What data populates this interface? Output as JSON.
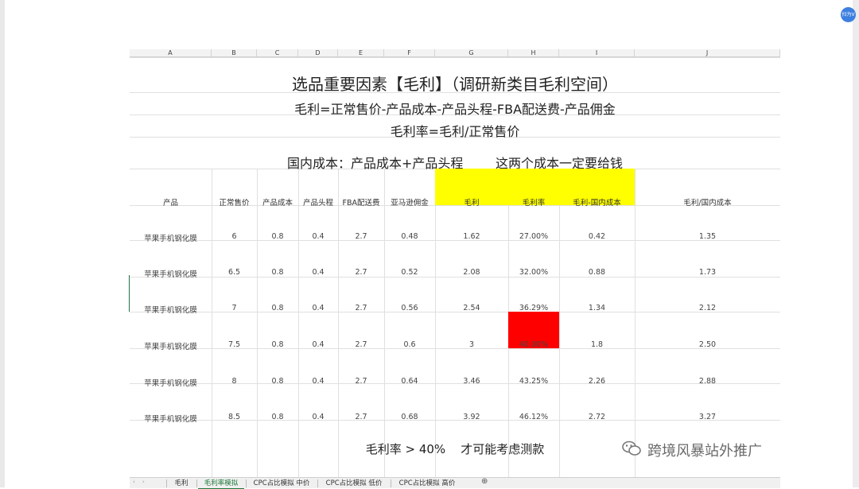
{
  "avatar_text": "扫为V",
  "columns": [
    "A",
    "B",
    "C",
    "D",
    "E",
    "F",
    "G",
    "H",
    "I",
    "J"
  ],
  "title": "选品重要因素【毛利】（调研新类目毛利空间）",
  "formula1": "毛利=正常售价-产品成本-产品头程-FBA配送费-产品佣金",
  "formula2": "毛利率=毛利/正常售价",
  "domestic": "国内成本：产品成本+产品头程        这两个成本一定要给钱",
  "headers": [
    "产品",
    "正常售价",
    "产品成本",
    "产品头程",
    "FBA配送费",
    "亚马逊佣金",
    "毛利",
    "毛利率",
    "毛利-国内成本",
    "毛利/国内成本"
  ],
  "rows": [
    [
      "苹果手机钢化膜",
      "6",
      "0.8",
      "0.4",
      "2.7",
      "0.48",
      "1.62",
      "27.00%",
      "0.42",
      "1.35"
    ],
    [
      "苹果手机钢化膜",
      "6.5",
      "0.8",
      "0.4",
      "2.7",
      "0.52",
      "2.08",
      "32.00%",
      "0.88",
      "1.73"
    ],
    [
      "苹果手机钢化膜",
      "7",
      "0.8",
      "0.4",
      "2.7",
      "0.56",
      "2.54",
      "36.29%",
      "1.34",
      "2.12"
    ],
    [
      "苹果手机钢化膜",
      "7.5",
      "0.8",
      "0.4",
      "2.7",
      "0.6",
      "3",
      "40.00%",
      "1.8",
      "2.50"
    ],
    [
      "苹果手机钢化膜",
      "8",
      "0.8",
      "0.4",
      "2.7",
      "0.64",
      "3.46",
      "43.25%",
      "2.26",
      "2.88"
    ],
    [
      "苹果手机钢化膜",
      "8.5",
      "0.8",
      "0.4",
      "2.7",
      "0.68",
      "3.92",
      "46.12%",
      "2.72",
      "3.27"
    ]
  ],
  "highlight_colors": {
    "header_fill": "#ffff00",
    "alert_fill": "#ff0000",
    "active_tab": "#1e7a3c"
  },
  "note": "毛利率 > 40%    才可能考虑测款",
  "tabs": [
    "毛利",
    "毛利率模拟",
    "CPC占比模拟 中价",
    "CPC占比模拟 低价",
    "CPC占比模拟 高价"
  ],
  "active_tab": "毛利率模拟",
  "watermark": "跨境风暴站外推广"
}
